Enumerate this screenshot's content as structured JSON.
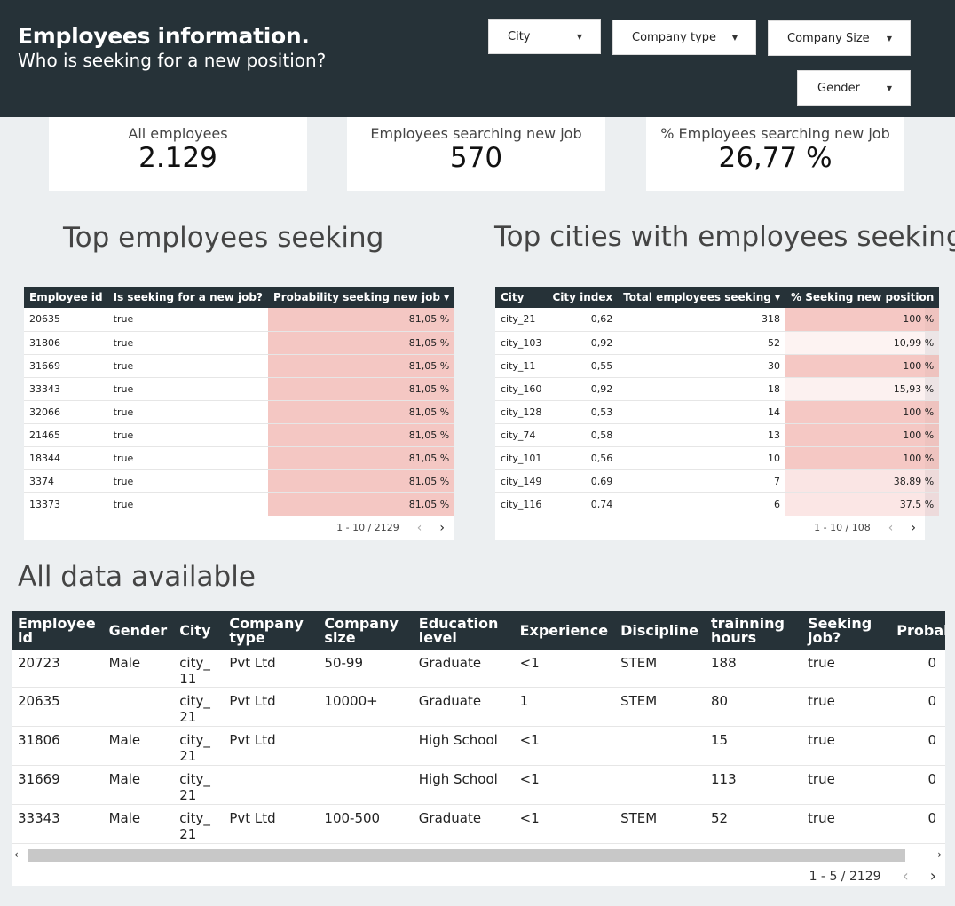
{
  "header": {
    "title": "Employees information.",
    "subtitle": "Who is seeking for a new position?"
  },
  "filters": {
    "city": "City",
    "company_type": "Company type",
    "company_size": "Company Size",
    "gender": "Gender"
  },
  "cards": [
    {
      "label": "All employees",
      "value": "2.129"
    },
    {
      "label": "Employees searching new job",
      "value": "570"
    },
    {
      "label": "% Employees searching new job",
      "value": "26,77 %"
    }
  ],
  "top_employees": {
    "title": "Top employees seeking",
    "headers": [
      "Employee id",
      "Is seeking for a new job?",
      "Probability seeking new job ▾"
    ],
    "rows": [
      [
        "20635",
        "true",
        "81,05 %"
      ],
      [
        "31806",
        "true",
        "81,05 %"
      ],
      [
        "31669",
        "true",
        "81,05 %"
      ],
      [
        "33343",
        "true",
        "81,05 %"
      ],
      [
        "32066",
        "true",
        "81,05 %"
      ],
      [
        "21465",
        "true",
        "81,05 %"
      ],
      [
        "18344",
        "true",
        "81,05 %"
      ],
      [
        "3374",
        "true",
        "81,05 %"
      ],
      [
        "13373",
        "true",
        "81,05 %"
      ]
    ],
    "pager": "1 - 10 / 2129"
  },
  "top_cities": {
    "title": "Top cities with employees seeking",
    "headers": [
      "City",
      "City index",
      "Total employees seeking ▾",
      "% Seeking new position"
    ],
    "rows": [
      [
        "city_21",
        "0,62",
        "318",
        "100 %"
      ],
      [
        "city_103",
        "0,92",
        "52",
        "10,99 %"
      ],
      [
        "city_11",
        "0,55",
        "30",
        "100 %"
      ],
      [
        "city_160",
        "0,92",
        "18",
        "15,93 %"
      ],
      [
        "city_128",
        "0,53",
        "14",
        "100 %"
      ],
      [
        "city_74",
        "0,58",
        "13",
        "100 %"
      ],
      [
        "city_101",
        "0,56",
        "10",
        "100 %"
      ],
      [
        "city_149",
        "0,69",
        "7",
        "38,89 %"
      ],
      [
        "city_116",
        "0,74",
        "6",
        "37,5 %"
      ]
    ],
    "heat": [
      1,
      0.11,
      1,
      0.16,
      1,
      1,
      1,
      0.39,
      0.375
    ],
    "pager": "1 - 10 / 108"
  },
  "all_data": {
    "title": "All data available",
    "headers": [
      "Employee id",
      "Gender",
      "City",
      "Company type",
      "Company size",
      "Education level",
      "Experience",
      "Discipline",
      "trainning hours",
      "Seeking job?",
      "Probabil"
    ],
    "rows": [
      [
        "20723",
        "Male",
        "city_11",
        "Pvt Ltd",
        "50-99",
        "Graduate",
        "<1",
        "STEM",
        "188",
        "true",
        "0"
      ],
      [
        "20635",
        "",
        "city_21",
        "Pvt Ltd",
        "10000+",
        "Graduate",
        "1",
        "STEM",
        "80",
        "true",
        "0"
      ],
      [
        "31806",
        "Male",
        "city_21",
        "Pvt Ltd",
        "",
        "High School",
        "<1",
        "",
        "15",
        "true",
        "0"
      ],
      [
        "31669",
        "Male",
        "city_21",
        "",
        "",
        "High School",
        "<1",
        "",
        "113",
        "true",
        "0"
      ],
      [
        "33343",
        "Male",
        "city_21",
        "Pvt Ltd",
        "100-500",
        "Graduate",
        "<1",
        "STEM",
        "52",
        "true",
        "0"
      ]
    ],
    "pager": "1 - 5 / 2129"
  },
  "colors": {
    "header_bg": "#263238",
    "heat": "#f4c7c3",
    "background": "#eceff1"
  }
}
